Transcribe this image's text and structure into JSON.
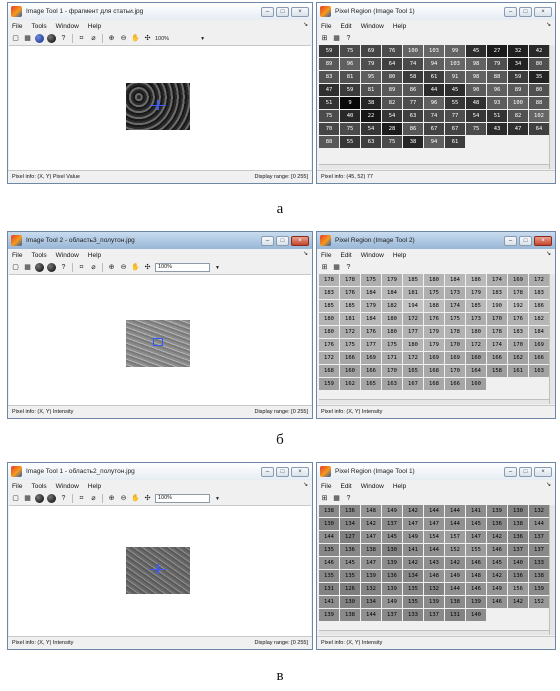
{
  "panels": [
    {
      "label": "а",
      "image_tool": {
        "title": "Image Tool 1 - фрагмент для статьи.jpg",
        "menu": [
          "File",
          "Tools",
          "Window",
          "Help"
        ],
        "zoom": "100%",
        "status_left": "Pixel info: (X, Y)  Pixel Value",
        "status_right": "Display range: [0 255]"
      },
      "pixel_region": {
        "title": "Pixel Region (Image Tool 1)",
        "menu": [
          "File",
          "Edit",
          "Window",
          "Help"
        ],
        "status": "Pixel info: (45, 52)  77",
        "rows": [
          [
            "59",
            "75",
            "69",
            "76",
            "100",
            "103",
            "99",
            "45",
            "27",
            "32",
            "42",
            "89"
          ],
          [
            "96",
            "79",
            "64",
            "74",
            "94",
            "103",
            "98",
            "79",
            "34",
            "80",
            "83",
            "81"
          ],
          [
            "95",
            "80",
            "58",
            "61",
            "91",
            "98",
            "88",
            "59",
            "35",
            "47",
            "59",
            "81"
          ],
          [
            "89",
            "86",
            "44",
            "45",
            "90",
            "96",
            "89",
            "80",
            "51",
            "9",
            "38",
            "82"
          ],
          [
            "77",
            "96",
            "55",
            "48",
            "93",
            "100",
            "88",
            "75",
            "40",
            "22",
            "54",
            "63"
          ],
          [
            "74",
            "77",
            "54",
            "51",
            "82",
            "102",
            "70",
            "75",
            "54",
            "28",
            "86",
            "67"
          ],
          [
            "67",
            "75",
            "43",
            "47",
            "64",
            "88",
            "55",
            "63",
            "75",
            "38",
            "94",
            "61"
          ]
        ]
      }
    },
    {
      "label": "б",
      "image_tool": {
        "title": "Image Tool 2 - область3_полутон.jpg",
        "menu": [
          "File",
          "Tools",
          "Window",
          "Help"
        ],
        "zoom": "100%",
        "status_left": "Pixel info: (X, Y)  Intensity",
        "status_right": "Display range: [0 255]"
      },
      "pixel_region": {
        "title": "Pixel Region (Image Tool 2)",
        "menu": [
          "File",
          "Edit",
          "Window",
          "Help"
        ],
        "status": "Pixel info: (X, Y)  Intensity",
        "rows": [
          [
            "178",
            "178",
            "175",
            "179",
            "185",
            "180",
            "184",
            "186",
            "174",
            "169",
            "172",
            "183"
          ],
          [
            "176",
            "184",
            "184",
            "181",
            "175",
            "173",
            "179",
            "183",
            "178",
            "183",
            "185",
            "185"
          ],
          [
            "179",
            "182",
            "194",
            "188",
            "174",
            "185",
            "190",
            "192",
            "186",
            "180",
            "181",
            "184"
          ],
          [
            "180",
            "172",
            "176",
            "175",
            "173",
            "170",
            "176",
            "182",
            "180",
            "172",
            "176",
            "180"
          ],
          [
            "177",
            "179",
            "178",
            "180",
            "178",
            "183",
            "184",
            "176",
            "175",
            "177",
            "175",
            "180"
          ],
          [
            "179",
            "170",
            "172",
            "174",
            "170",
            "169",
            "172",
            "166",
            "169",
            "171",
            "172",
            "169"
          ],
          [
            "169",
            "160",
            "166",
            "162",
            "166",
            "168",
            "160",
            "166",
            "170",
            "165",
            "168",
            "170"
          ],
          [
            "164",
            "158",
            "161",
            "163",
            "159",
            "162",
            "165",
            "163",
            "167",
            "168",
            "166",
            "160"
          ]
        ]
      }
    },
    {
      "label": "в",
      "image_tool": {
        "title": "Image Tool 1 - область2_полутон.jpg",
        "menu": [
          "File",
          "Tools",
          "Window",
          "Help"
        ],
        "zoom": "100%",
        "status_left": "Pixel info: (X, Y)  Intensity",
        "status_right": "Display range: [0 255]"
      },
      "pixel_region": {
        "title": "Pixel Region (Image Tool 1)",
        "menu": [
          "File",
          "Edit",
          "Window",
          "Help"
        ],
        "status": "Pixel info: (X, Y)  Intensity",
        "rows": [
          [
            "138",
            "136",
            "148",
            "149",
            "142",
            "144",
            "144",
            "141",
            "139",
            "130",
            "132",
            "130"
          ],
          [
            "134",
            "142",
            "137",
            "147",
            "147",
            "144",
            "145",
            "136",
            "138",
            "144",
            "144",
            "127"
          ],
          [
            "147",
            "145",
            "149",
            "154",
            "157",
            "147",
            "142",
            "136",
            "137",
            "135",
            "136",
            "138"
          ],
          [
            "130",
            "141",
            "144",
            "152",
            "155",
            "146",
            "137",
            "137",
            "146",
            "145",
            "147",
            "139"
          ],
          [
            "142",
            "143",
            "142",
            "146",
            "145",
            "140",
            "133",
            "135",
            "135",
            "139",
            "136",
            "134"
          ],
          [
            "148",
            "149",
            "148",
            "142",
            "136",
            "138",
            "131",
            "126",
            "132",
            "139",
            "135",
            "132"
          ],
          [
            "144",
            "146",
            "149",
            "156",
            "139",
            "141",
            "130",
            "134",
            "149",
            "135",
            "139",
            "138"
          ],
          [
            "139",
            "146",
            "142",
            "152",
            "139",
            "138",
            "144",
            "137",
            "133",
            "137",
            "131",
            "140"
          ]
        ]
      }
    }
  ]
}
